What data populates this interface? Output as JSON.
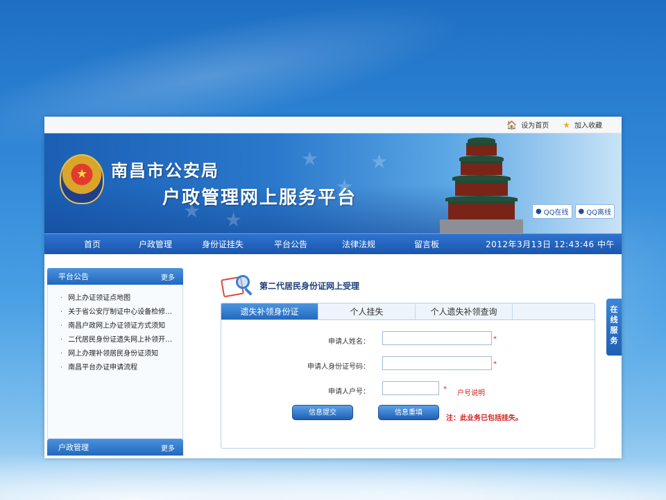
{
  "topbar": {
    "set_home": "设为首页",
    "add_fav": "加入收藏"
  },
  "banner": {
    "title1": "南昌市公安局",
    "title2": "户政管理网上服务平台",
    "qq_online": "QQ在线",
    "qq_offline": "QQ离线"
  },
  "nav": {
    "items": [
      "首页",
      "户政管理",
      "身份证挂失",
      "平台公告",
      "法律法规",
      "留言板"
    ],
    "clock": "2012年3月13日 12:43:46 中午"
  },
  "sidebar": {
    "notice_title": "平台公告",
    "more": "更多",
    "items": [
      "网上办证领证点地图",
      "关于省公安厅制证中心设备检修…",
      "南昌户政网上办证领证方式须知",
      "二代居民身份证遗失网上补领开…",
      "网上办理补领居民身份证须知",
      "南昌平台办证申请流程"
    ],
    "huzheng_title": "户政管理",
    "more2": "更多"
  },
  "main": {
    "form_title": "第二代居民身份证网上受理",
    "tabs": [
      "遗失补领身份证",
      "个人挂失",
      "个人遗失补领查询"
    ],
    "label_name": "申请人姓名：",
    "label_id": "申请人身份证号码：",
    "label_hukou": "申请人户号：",
    "required": "*",
    "hukou_help": "户号说明",
    "submit": "信息提交",
    "reset": "信息重填",
    "note": "注：此业务已包括挂失。",
    "name_value": "",
    "id_value": "",
    "hukou_value": ""
  },
  "online_service": "在线服务",
  "colors": {
    "nav_blue": "#1a55ad",
    "accent_blue": "#2369bf",
    "required_red": "#d12020"
  }
}
